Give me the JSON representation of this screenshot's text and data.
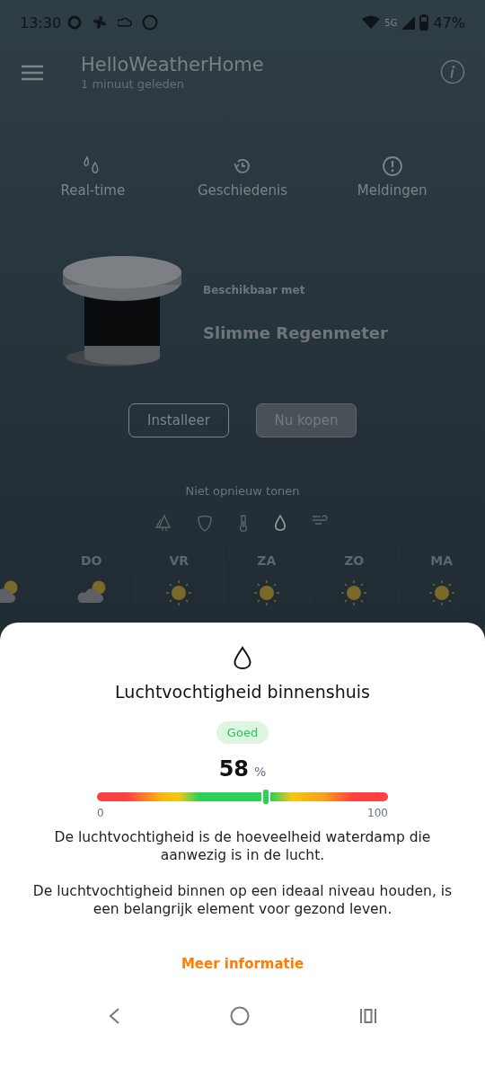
{
  "status_bar": {
    "time": "13:30",
    "network": "5G",
    "battery": "47%"
  },
  "header": {
    "title": "HelloWeatherHome",
    "subtitle": "1 minuut geleden"
  },
  "tabs": [
    {
      "label": "Real-time",
      "kind": "drops"
    },
    {
      "label": "Geschiedenis",
      "kind": "history"
    },
    {
      "label": "Meldingen",
      "kind": "alert"
    }
  ],
  "promo": {
    "caption": "Beschikbaar met",
    "product": "Slimme Regenmeter",
    "buttons": [
      {
        "label": "Installeer",
        "kind": "outline"
      },
      {
        "label": "Nu kopen",
        "kind": "filled"
      }
    ],
    "dismiss": "Niet opnieuw tonen"
  },
  "measure_icons": [
    {
      "kind": "tree",
      "selected": false
    },
    {
      "kind": "shield",
      "selected": false
    },
    {
      "kind": "thermometer",
      "selected": false
    },
    {
      "kind": "drop",
      "selected": true
    },
    {
      "kind": "wind",
      "selected": false
    }
  ],
  "forecast": [
    {
      "kind": "partly-cloudy"
    },
    {
      "day": "DO",
      "kind": "partly-cloudy"
    },
    {
      "day": "VR",
      "kind": "sunny"
    },
    {
      "day": "ZA",
      "kind": "sunny"
    },
    {
      "day": "ZO",
      "kind": "sunny"
    },
    {
      "day": "MA",
      "kind": "sunny"
    }
  ],
  "sheet": {
    "title": "Luchtvochtigheid binnenshuis",
    "status": "Goed",
    "value": "58",
    "unit": "%",
    "level": 0.58,
    "min": "0",
    "max": "100",
    "paragraphs": [
      "De luchtvochtigheid is de hoeveelheid waterdamp die aanwezig is in de lucht.",
      "De luchtvochtigheid binnen op een ideaal niveau houden, is een belangrijk element voor gezond leven."
    ],
    "link": "Meer informatie"
  }
}
